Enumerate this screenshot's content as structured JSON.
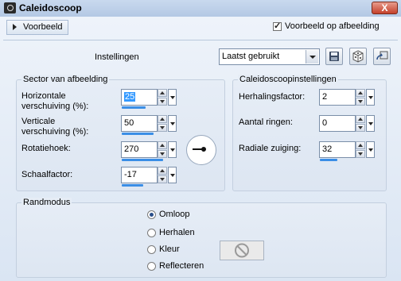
{
  "window": {
    "title": "Caleidoscoop",
    "close_glyph": "X"
  },
  "preview": {
    "toggle_label": "Voorbeeld",
    "checkbox_label": "Voorbeeld op afbeelding",
    "checked": true
  },
  "settings": {
    "label": "Instellingen",
    "preset_value": "Laatst gebruikt"
  },
  "sector": {
    "title": "Sector van afbeelding",
    "fields": [
      {
        "label_line1": "Horizontale",
        "label_line2": "verschuiving (%):",
        "value": "25"
      },
      {
        "label_line1": "Verticale",
        "label_line2": "verschuiving (%):",
        "value": "50"
      },
      {
        "label_line1": "Rotatiehoek:",
        "label_line2": "",
        "value": "270"
      },
      {
        "label_line1": "Schaalfactor:",
        "label_line2": "",
        "value": "-17"
      }
    ]
  },
  "kaleido": {
    "title": "Caleidoscoopinstellingen",
    "fields": [
      {
        "label": "Herhalingsfactor:",
        "value": "2"
      },
      {
        "label": "Aantal ringen:",
        "value": "0"
      },
      {
        "label": "Radiale zuiging:",
        "value": "32"
      }
    ]
  },
  "edge": {
    "title": "Randmodus",
    "options": [
      "Omloop",
      "Herhalen",
      "Kleur",
      "Reflecteren"
    ],
    "selected": "Omloop"
  },
  "colors": {
    "accent": "#3a8ee6",
    "selection": "#3399ff",
    "close": "#c4402a"
  }
}
